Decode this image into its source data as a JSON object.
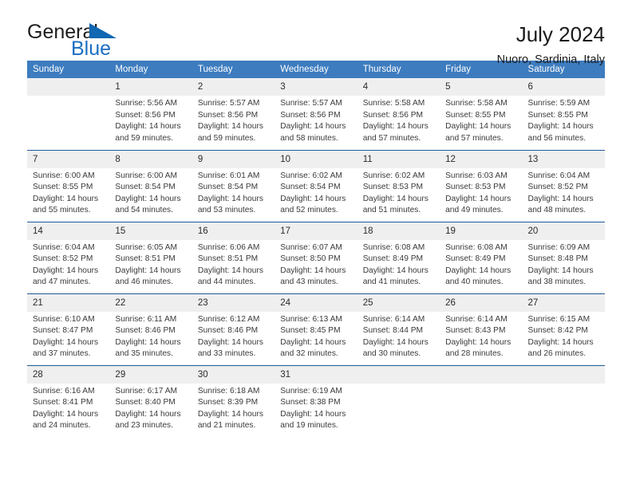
{
  "brand": {
    "word_one": "General",
    "word_two": "Blue",
    "flag_icon": "blue-triangle-flag-icon",
    "accent_color": "#1167b1"
  },
  "header": {
    "title": "July 2024",
    "subtitle": "Nuoro, Sardinia, Italy"
  },
  "theme": {
    "header_bg": "#3d7cbf",
    "row_divider": "#1f5c99",
    "daynum_bg": "#efefef",
    "text": "#1a1a1a"
  },
  "weekday_headers": [
    "Sunday",
    "Monday",
    "Tuesday",
    "Wednesday",
    "Thursday",
    "Friday",
    "Saturday"
  ],
  "weeks": [
    [
      {
        "day": "",
        "sunrise": "",
        "sunset": "",
        "daylight_line1": "",
        "daylight_line2": ""
      },
      {
        "day": "1",
        "sunrise": "Sunrise: 5:56 AM",
        "sunset": "Sunset: 8:56 PM",
        "daylight_line1": "Daylight: 14 hours",
        "daylight_line2": "and 59 minutes."
      },
      {
        "day": "2",
        "sunrise": "Sunrise: 5:57 AM",
        "sunset": "Sunset: 8:56 PM",
        "daylight_line1": "Daylight: 14 hours",
        "daylight_line2": "and 59 minutes."
      },
      {
        "day": "3",
        "sunrise": "Sunrise: 5:57 AM",
        "sunset": "Sunset: 8:56 PM",
        "daylight_line1": "Daylight: 14 hours",
        "daylight_line2": "and 58 minutes."
      },
      {
        "day": "4",
        "sunrise": "Sunrise: 5:58 AM",
        "sunset": "Sunset: 8:56 PM",
        "daylight_line1": "Daylight: 14 hours",
        "daylight_line2": "and 57 minutes."
      },
      {
        "day": "5",
        "sunrise": "Sunrise: 5:58 AM",
        "sunset": "Sunset: 8:55 PM",
        "daylight_line1": "Daylight: 14 hours",
        "daylight_line2": "and 57 minutes."
      },
      {
        "day": "6",
        "sunrise": "Sunrise: 5:59 AM",
        "sunset": "Sunset: 8:55 PM",
        "daylight_line1": "Daylight: 14 hours",
        "daylight_line2": "and 56 minutes."
      }
    ],
    [
      {
        "day": "7",
        "sunrise": "Sunrise: 6:00 AM",
        "sunset": "Sunset: 8:55 PM",
        "daylight_line1": "Daylight: 14 hours",
        "daylight_line2": "and 55 minutes."
      },
      {
        "day": "8",
        "sunrise": "Sunrise: 6:00 AM",
        "sunset": "Sunset: 8:54 PM",
        "daylight_line1": "Daylight: 14 hours",
        "daylight_line2": "and 54 minutes."
      },
      {
        "day": "9",
        "sunrise": "Sunrise: 6:01 AM",
        "sunset": "Sunset: 8:54 PM",
        "daylight_line1": "Daylight: 14 hours",
        "daylight_line2": "and 53 minutes."
      },
      {
        "day": "10",
        "sunrise": "Sunrise: 6:02 AM",
        "sunset": "Sunset: 8:54 PM",
        "daylight_line1": "Daylight: 14 hours",
        "daylight_line2": "and 52 minutes."
      },
      {
        "day": "11",
        "sunrise": "Sunrise: 6:02 AM",
        "sunset": "Sunset: 8:53 PM",
        "daylight_line1": "Daylight: 14 hours",
        "daylight_line2": "and 51 minutes."
      },
      {
        "day": "12",
        "sunrise": "Sunrise: 6:03 AM",
        "sunset": "Sunset: 8:53 PM",
        "daylight_line1": "Daylight: 14 hours",
        "daylight_line2": "and 49 minutes."
      },
      {
        "day": "13",
        "sunrise": "Sunrise: 6:04 AM",
        "sunset": "Sunset: 8:52 PM",
        "daylight_line1": "Daylight: 14 hours",
        "daylight_line2": "and 48 minutes."
      }
    ],
    [
      {
        "day": "14",
        "sunrise": "Sunrise: 6:04 AM",
        "sunset": "Sunset: 8:52 PM",
        "daylight_line1": "Daylight: 14 hours",
        "daylight_line2": "and 47 minutes."
      },
      {
        "day": "15",
        "sunrise": "Sunrise: 6:05 AM",
        "sunset": "Sunset: 8:51 PM",
        "daylight_line1": "Daylight: 14 hours",
        "daylight_line2": "and 46 minutes."
      },
      {
        "day": "16",
        "sunrise": "Sunrise: 6:06 AM",
        "sunset": "Sunset: 8:51 PM",
        "daylight_line1": "Daylight: 14 hours",
        "daylight_line2": "and 44 minutes."
      },
      {
        "day": "17",
        "sunrise": "Sunrise: 6:07 AM",
        "sunset": "Sunset: 8:50 PM",
        "daylight_line1": "Daylight: 14 hours",
        "daylight_line2": "and 43 minutes."
      },
      {
        "day": "18",
        "sunrise": "Sunrise: 6:08 AM",
        "sunset": "Sunset: 8:49 PM",
        "daylight_line1": "Daylight: 14 hours",
        "daylight_line2": "and 41 minutes."
      },
      {
        "day": "19",
        "sunrise": "Sunrise: 6:08 AM",
        "sunset": "Sunset: 8:49 PM",
        "daylight_line1": "Daylight: 14 hours",
        "daylight_line2": "and 40 minutes."
      },
      {
        "day": "20",
        "sunrise": "Sunrise: 6:09 AM",
        "sunset": "Sunset: 8:48 PM",
        "daylight_line1": "Daylight: 14 hours",
        "daylight_line2": "and 38 minutes."
      }
    ],
    [
      {
        "day": "21",
        "sunrise": "Sunrise: 6:10 AM",
        "sunset": "Sunset: 8:47 PM",
        "daylight_line1": "Daylight: 14 hours",
        "daylight_line2": "and 37 minutes."
      },
      {
        "day": "22",
        "sunrise": "Sunrise: 6:11 AM",
        "sunset": "Sunset: 8:46 PM",
        "daylight_line1": "Daylight: 14 hours",
        "daylight_line2": "and 35 minutes."
      },
      {
        "day": "23",
        "sunrise": "Sunrise: 6:12 AM",
        "sunset": "Sunset: 8:46 PM",
        "daylight_line1": "Daylight: 14 hours",
        "daylight_line2": "and 33 minutes."
      },
      {
        "day": "24",
        "sunrise": "Sunrise: 6:13 AM",
        "sunset": "Sunset: 8:45 PM",
        "daylight_line1": "Daylight: 14 hours",
        "daylight_line2": "and 32 minutes."
      },
      {
        "day": "25",
        "sunrise": "Sunrise: 6:14 AM",
        "sunset": "Sunset: 8:44 PM",
        "daylight_line1": "Daylight: 14 hours",
        "daylight_line2": "and 30 minutes."
      },
      {
        "day": "26",
        "sunrise": "Sunrise: 6:14 AM",
        "sunset": "Sunset: 8:43 PM",
        "daylight_line1": "Daylight: 14 hours",
        "daylight_line2": "and 28 minutes."
      },
      {
        "day": "27",
        "sunrise": "Sunrise: 6:15 AM",
        "sunset": "Sunset: 8:42 PM",
        "daylight_line1": "Daylight: 14 hours",
        "daylight_line2": "and 26 minutes."
      }
    ],
    [
      {
        "day": "28",
        "sunrise": "Sunrise: 6:16 AM",
        "sunset": "Sunset: 8:41 PM",
        "daylight_line1": "Daylight: 14 hours",
        "daylight_line2": "and 24 minutes."
      },
      {
        "day": "29",
        "sunrise": "Sunrise: 6:17 AM",
        "sunset": "Sunset: 8:40 PM",
        "daylight_line1": "Daylight: 14 hours",
        "daylight_line2": "and 23 minutes."
      },
      {
        "day": "30",
        "sunrise": "Sunrise: 6:18 AM",
        "sunset": "Sunset: 8:39 PM",
        "daylight_line1": "Daylight: 14 hours",
        "daylight_line2": "and 21 minutes."
      },
      {
        "day": "31",
        "sunrise": "Sunrise: 6:19 AM",
        "sunset": "Sunset: 8:38 PM",
        "daylight_line1": "Daylight: 14 hours",
        "daylight_line2": "and 19 minutes."
      },
      {
        "day": "",
        "sunrise": "",
        "sunset": "",
        "daylight_line1": "",
        "daylight_line2": ""
      },
      {
        "day": "",
        "sunrise": "",
        "sunset": "",
        "daylight_line1": "",
        "daylight_line2": ""
      },
      {
        "day": "",
        "sunrise": "",
        "sunset": "",
        "daylight_line1": "",
        "daylight_line2": ""
      }
    ]
  ]
}
